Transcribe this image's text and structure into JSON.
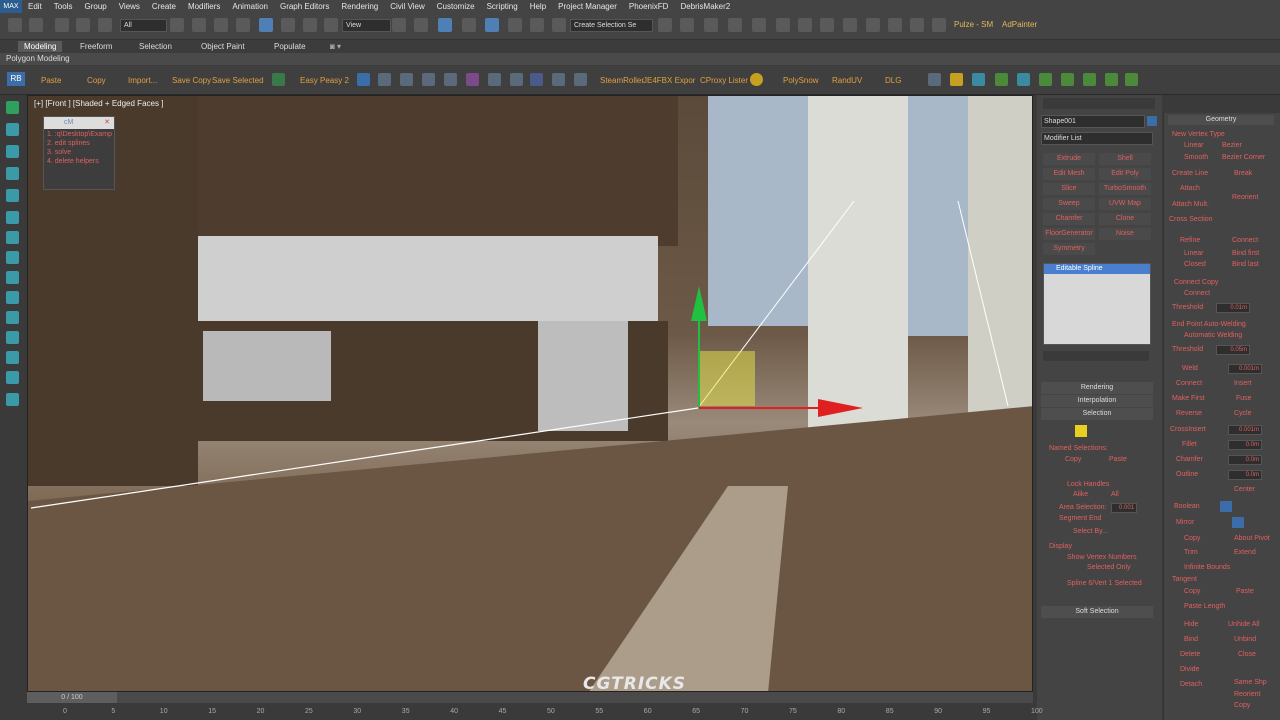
{
  "menu": [
    "Edit",
    "Tools",
    "Group",
    "Views",
    "Create",
    "Modifiers",
    "Animation",
    "Graph Editors",
    "Rendering",
    "Civil View",
    "Customize",
    "Scripting",
    "Help",
    "Project Manager",
    "PhoenixFD",
    "DebrisMaker2"
  ],
  "logo": "MAX",
  "toolbar": {
    "filter": "All",
    "view": "View",
    "named_selection": "Create Selection Se",
    "workspace": "Pulze - SM",
    "user": "AdPainter"
  },
  "ribbon": {
    "tabs": [
      "Modeling",
      "Freeform",
      "Selection",
      "Object Paint",
      "Populate"
    ],
    "active": "Modeling",
    "sub": "Polygon Modeling"
  },
  "shelf": {
    "badge": "RB",
    "items": [
      "Paste",
      "Copy",
      "Import...",
      "Save Copy",
      "Save Selected",
      "Easy Peasy 2",
      "SteamRoller",
      "JE4FBX Expor",
      "CProxy Lister",
      "PolySnow",
      "RandUV",
      "DLG"
    ]
  },
  "viewport": {
    "label": "[+] [Front ] [Shaded + Edged Faces ]",
    "watermark": "CGTRICKS"
  },
  "float_panel": {
    "title": "cM",
    "rows": [
      "1. :q\\Desktop\\Examp",
      "2. edit splines",
      "3. solve",
      "4. delete helpers"
    ]
  },
  "command_panel": {
    "object_name": "Shape001",
    "modifier_list": "Modifier List",
    "modifiers": [
      [
        "Extrude",
        "Shell"
      ],
      [
        "Edit Mesh",
        "Edit Poly"
      ],
      [
        "Slice",
        "TurboSmooth"
      ],
      [
        "Sweep",
        "UVW Map"
      ],
      [
        "Chamfer",
        "Clone"
      ],
      [
        "FloorGenerator",
        "Noise"
      ],
      [
        "Symmetry",
        ""
      ]
    ],
    "stack_item": "Editable Spline",
    "rollouts": [
      "Rendering",
      "Interpolation",
      "Selection"
    ],
    "named_selections": "Named Selections:",
    "copy": "Copy",
    "paste": "Paste",
    "lock_handles": "Lock Handles",
    "alike": "Alike",
    "all": "All",
    "area_selection": "Area Selection:",
    "area_value": "0.001",
    "segment_end": "Segment End",
    "select_by": "Select By...",
    "display": "Display",
    "show_vertex_numbers": "Show Vertex Numbers",
    "selected_only": "Selected Only",
    "status": "Spline 6/Vert 1 Selected",
    "soft_selection": "Soft Selection"
  },
  "geometry_panel": {
    "title": "Geometry",
    "new_vertex_type": "New Vertex Type",
    "linear": "Linear",
    "bezier": "Bezier",
    "smooth": "Smooth",
    "bezier_corner": "Bezier Corner",
    "create_line": "Create Line",
    "break": "Break",
    "attach": "Attach",
    "reorient": "Reorient",
    "attach_mult": "Attach Mult.",
    "cross_section": "Cross Section",
    "refine": "Refine",
    "connect": "Connect",
    "linear2": "Linear",
    "bind_first": "Bind first",
    "closed": "Closed",
    "bind_last": "Bind last",
    "connect_copy": "Connect Copy",
    "connect2": "Connect",
    "threshold": "Threshold",
    "threshold_val": "0.01m",
    "end_point": "End Point Auto-Welding",
    "auto_welding": "Automatic Welding",
    "threshold2": "Threshold",
    "threshold2_val": "0.05m",
    "weld": "Weld",
    "weld_val": "0.001m",
    "connect3": "Connect",
    "insert": "Insert",
    "make_first": "Make First",
    "fuse": "Fuse",
    "reverse": "Reverse",
    "cycle": "Cycle",
    "crossinsert": "CrossInsert",
    "crossinsert_val": "0.001m",
    "fillet": "Fillet",
    "fillet_val": "0.0m",
    "chamfer": "Chamfer",
    "chamfer_val": "0.0m",
    "outline": "Outline",
    "outline_val": "0.0m",
    "center": "Center",
    "boolean": "Boolean",
    "mirror": "Mirror",
    "copy": "Copy",
    "about_pivot": "About Pivot",
    "trim": "Trim",
    "extend": "Extend",
    "infinite_bounds": "Infinite Bounds",
    "tangent": "Tangent",
    "copy2": "Copy",
    "paste2": "Paste",
    "paste_length": "Paste Length",
    "hide": "Hide",
    "unhide_all": "Unhide All",
    "bind": "Bind",
    "unbind": "Unbind",
    "delete": "Delete",
    "close": "Close",
    "divide": "Divide",
    "detach": "Detach",
    "same_shp": "Same Shp",
    "reorient2": "Reorient",
    "copy3": "Copy"
  },
  "timeline": {
    "slider": "0 / 100",
    "ticks": [
      "0",
      "5",
      "10",
      "15",
      "20",
      "25",
      "30",
      "35",
      "40",
      "45",
      "50",
      "55",
      "60",
      "65",
      "70",
      "75",
      "80",
      "85",
      "90",
      "95",
      "100"
    ]
  },
  "colors": {
    "accent": "#4e7fb5",
    "selection": "#e8e84a",
    "axis_x": "#e02020",
    "axis_y": "#20c040"
  }
}
